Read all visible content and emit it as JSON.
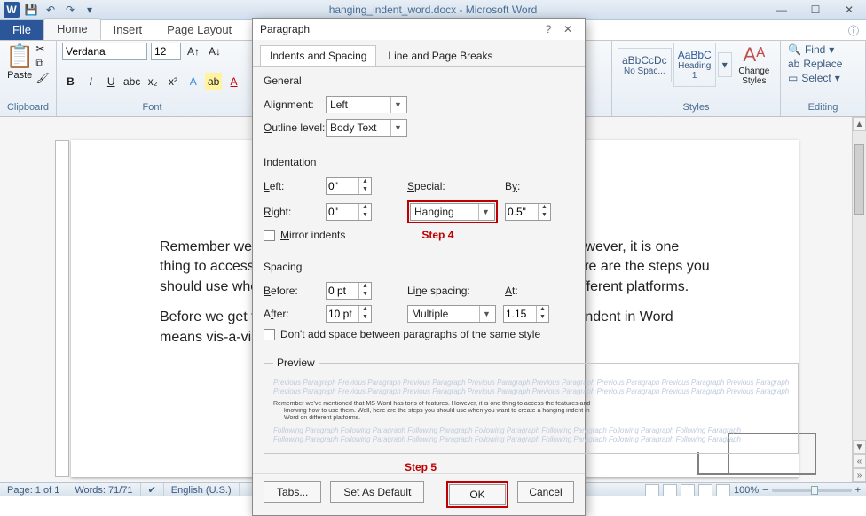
{
  "titlebar": {
    "title": "hanging_indent_word.docx - Microsoft Word"
  },
  "tabs": {
    "file": "File",
    "home": "Home",
    "insert": "Insert",
    "page_layout": "Page Layout"
  },
  "ribbon_groups": {
    "clipboard": "Clipboard",
    "font": "Font",
    "styles": "Styles",
    "editing": "Editing"
  },
  "clipboard": {
    "paste": "Paste"
  },
  "font": {
    "name": "Verdana",
    "size": "12"
  },
  "styles": {
    "chip1": "aBbCcDc",
    "chip2": "AaBbC",
    "nospacing": "No Spac...",
    "heading1": "Heading 1",
    "change_styles": "Change Styles"
  },
  "editing": {
    "find": "Find",
    "replace": "Replace",
    "select": "Select"
  },
  "document": {
    "p1": "Remember we've mentioned that MS Word has tons of features. However, it is one thing to access the features and knowing how to use them. Well, here are the steps you should use when you want to create a hanging indent in Word on different platforms.",
    "p2": "Before we get to the steps, it is important we cover what a hanging indent in Word means vis-a-vis other indents done with the tab character."
  },
  "status": {
    "page": "Page: 1 of 1",
    "words": "Words: 71/71",
    "lang": "English (U.S.)",
    "zoom": "100%"
  },
  "dialog": {
    "title": "Paragraph",
    "tab_indents": "Indents and Spacing",
    "tab_linebreaks": "Line and Page Breaks",
    "section_general": "General",
    "alignment_label": "Alignment:",
    "alignment_value": "Left",
    "outline_label": "Outline level:",
    "outline_value": "Body Text",
    "section_indentation": "Indentation",
    "left_label": "Left:",
    "left_value": "0\"",
    "right_label": "Right:",
    "right_value": "0\"",
    "special_label": "Special:",
    "special_value": "Hanging",
    "by_label": "By:",
    "by_value": "0.5\"",
    "mirror_label": "Mirror indents",
    "step4": "Step 4",
    "section_spacing": "Spacing",
    "before_label": "Before:",
    "before_value": "0 pt",
    "after_label": "After:",
    "after_value": "10 pt",
    "linespacing_label": "Line spacing:",
    "linespacing_value": "Multiple",
    "at_label": "At:",
    "at_value": "1.15",
    "dont_add_label": "Don't add space between paragraphs of the same style",
    "preview_label": "Preview",
    "preview_faint": "Previous Paragraph Previous Paragraph Previous Paragraph Previous Paragraph Previous Paragraph Previous Paragraph Previous Paragraph Previous Paragraph",
    "preview_body1": "Remember we've mentioned that MS Word has tons of features. However, it is one thing to access the features and",
    "preview_body2": "knowing how to use them. Well, here are the steps you should use when you want to create a hanging indent in",
    "preview_body3": "Word on different platforms.",
    "preview_follow": "Following Paragraph Following Paragraph Following Paragraph Following Paragraph Following Paragraph Following Paragraph Following Paragraph",
    "step5": "Step 5",
    "tabs_btn": "Tabs...",
    "default_btn": "Set As Default",
    "ok_btn": "OK",
    "cancel_btn": "Cancel"
  }
}
